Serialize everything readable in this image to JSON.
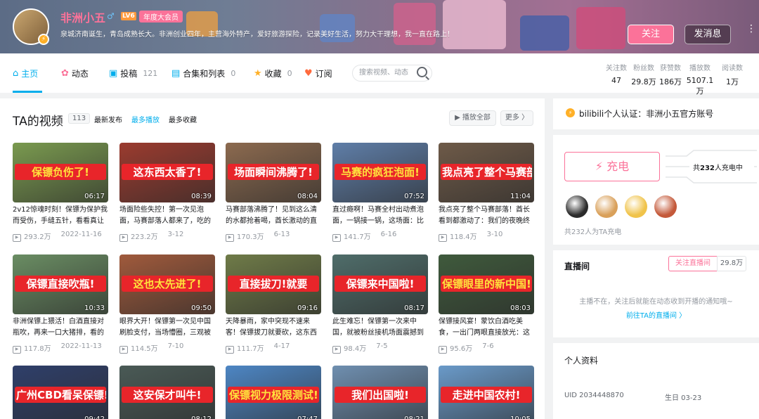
{
  "header": {
    "username": "非洲小五",
    "gender_symbol": "♂",
    "level": "LV6",
    "vip_badge": "年度大会员",
    "signature": "泉城济南诞生，青岛成熟长大。非洲创业四年，主营海外特产，爱好旅游探险，记录美好生活，努力大干理想，我一直在路上！",
    "follow_label": "关注",
    "message_label": "发消息",
    "more_label": "⋮"
  },
  "nav": {
    "tabs": [
      {
        "label": "主页",
        "icon": "home-icon",
        "glyph": "⌂",
        "count": "",
        "color": "#00aeec"
      },
      {
        "label": "动态",
        "icon": "activity-icon",
        "glyph": "✿",
        "count": "",
        "color": "#fb7299"
      },
      {
        "label": "投稿",
        "icon": "video-icon",
        "glyph": "▣",
        "count": "121",
        "color": "#00aeec"
      },
      {
        "label": "合集和列表",
        "icon": "collection-icon",
        "glyph": "▤",
        "count": "0",
        "color": "#00aeec"
      },
      {
        "label": "收藏",
        "icon": "star-icon",
        "glyph": "★",
        "count": "0",
        "color": "#ffb027"
      },
      {
        "label": "订阅",
        "icon": "heart-icon",
        "glyph": "♥",
        "count": "",
        "color": "#ff6a3d"
      }
    ],
    "search_placeholder": "搜索视频、动态",
    "stats": [
      {
        "label": "关注数",
        "value": "47"
      },
      {
        "label": "粉丝数",
        "value": "29.8万"
      },
      {
        "label": "获赞数",
        "value": "186万"
      },
      {
        "label": "播放数",
        "value": "5107.1万"
      },
      {
        "label": "阅读数",
        "value": "1万"
      }
    ]
  },
  "videos": {
    "title": "TA的视频",
    "count": "113",
    "sort_options": [
      "最新发布",
      "最多播放",
      "最多收藏"
    ],
    "active_sort": "最多播放",
    "play_all_label": "▶ 播放全部",
    "more_label": "更多 〉",
    "items": [
      {
        "caption": "保镖负伤了!",
        "duration": "06:17",
        "title": "2v12惊魂时刻！保镖为保护我而受伤，手缝五针，看看真让",
        "plays": "293.2万",
        "date": "2022-11-16",
        "bg": "#7a9a4f"
      },
      {
        "caption": "这东西太香了!",
        "duration": "08:39",
        "title": "场面险些失控！第一次见泡面，马赛部落人都来了，吃的",
        "plays": "223.2万",
        "date": "3-12",
        "bg": "#9b3b2f"
      },
      {
        "caption": "场面瞬间沸腾了!",
        "duration": "08:04",
        "title": "马赛部落沸腾了！见到这么清的水都抢着喝，酋长激动的直",
        "plays": "170.3万",
        "date": "6-13",
        "bg": "#8c6a4f"
      },
      {
        "caption": "马赛的疯狂泡面!",
        "duration": "07:52",
        "title": "直过瘾啊！马赛全村出动煮泡面，一锅接一锅，这场面：比",
        "plays": "141.7万",
        "date": "6-16",
        "bg": "#5f7ea8"
      },
      {
        "caption": "我点亮了整个马赛部落!",
        "duration": "11:04",
        "title": "我点亮了整个马赛部落！酋长看到都激动了：我们的夜晚终",
        "plays": "118.4万",
        "date": "3-10",
        "bg": "#6e5a48"
      },
      {
        "caption": "保镖直接吹瓶!",
        "duration": "10:33",
        "title": "非洲保镖上猥活！白酒直接对瓶吹，再来一口大猪排，看的",
        "plays": "117.8万",
        "date": "2022-11-13",
        "bg": "#6a8d63"
      },
      {
        "caption": "这也太先进了!",
        "duration": "09:50",
        "title": "眼界大开！保镖第一次见中国刷脸支付，当场懵圈，三观被",
        "plays": "114.5万",
        "date": "7-10",
        "bg": "#a05a3c"
      },
      {
        "caption": "直接拔刀!就要",
        "duration": "09:16",
        "title": "天降暴雨，家中突现不速来客！保镖拔刀就要砍，这东西",
        "plays": "111.7万",
        "date": "4-17",
        "bg": "#6f7b48"
      },
      {
        "caption": "保镖来中国啦!",
        "duration": "08:17",
        "title": "此生难忘！保镖第一次来中国，就被粉丝接机场面震撼到",
        "plays": "98.4万",
        "date": "7-5",
        "bg": "#4f6d6a"
      },
      {
        "caption": "保镖眼里的新中国!",
        "duration": "08:03",
        "title": "保镖接风宴！蒙饮白酒吃美食，一出门两眼直接放光：这",
        "plays": "95.6万",
        "date": "7-6",
        "bg": "#3f5a3c"
      },
      {
        "caption": "广州CBD看呆保镖!",
        "duration": "09:42",
        "title": "",
        "plays": "",
        "date": "",
        "bg": "#2f3f6a"
      },
      {
        "caption": "这安保才叫牛!",
        "duration": "08:12",
        "title": "",
        "plays": "",
        "date": "",
        "bg": "#4a5a56"
      },
      {
        "caption": "保镖视力极限测试!",
        "duration": "07:47",
        "title": "",
        "plays": "",
        "date": "",
        "bg": "#4d86c4"
      },
      {
        "caption": "我们出国啦!",
        "duration": "08:21",
        "title": "",
        "plays": "",
        "date": "",
        "bg": "#6f8fb0"
      },
      {
        "caption": "走进中国农村!",
        "duration": "10:05",
        "title": "",
        "plays": "",
        "date": "",
        "bg": "#6a9ac9"
      }
    ]
  },
  "certification": {
    "text": "bilibili个人认证：非洲小五官方账号"
  },
  "charge": {
    "button_label": "⚡ 充电",
    "count_prefix": "共",
    "count": "232",
    "count_suffix": "人充电中",
    "footer": "共232人为TA充电",
    "fan_colors": [
      "#2b2b2b",
      "#d9a05a",
      "#f0c34a",
      "#c4593a"
    ]
  },
  "live": {
    "title": "直播间",
    "follow_label": "关注直播间",
    "count": "29.8万",
    "message": "主播不在，关注后就能在动态收到开播的通知哦~",
    "link": "前往TA的直播间 〉"
  },
  "profile": {
    "title": "个人资料",
    "uid": "UID  2034448870",
    "birthday": "生日  03-23"
  }
}
